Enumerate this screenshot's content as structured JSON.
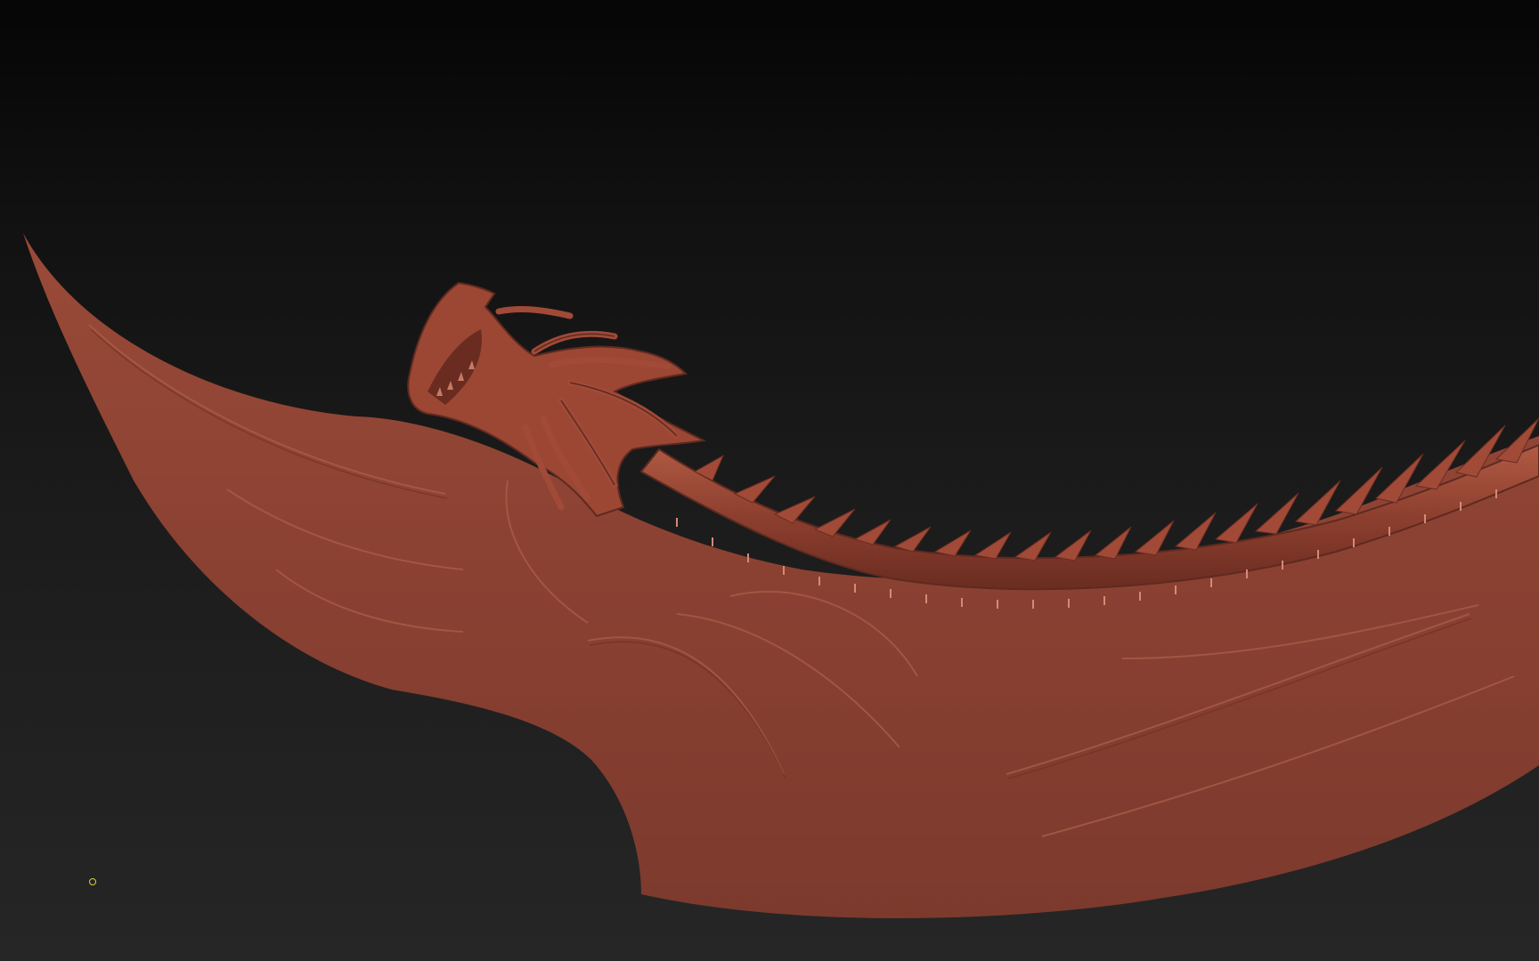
{
  "viewport": {
    "background_top": "#050505",
    "background_bottom": "#262626"
  },
  "model": {
    "description_icon": "sculpt-mesh",
    "material_color": "#8a4132",
    "highlight_color": "#b0604a",
    "shadow_color": "#5e2a20"
  },
  "cursor": {
    "icon": "brush-cursor-icon",
    "color": "#d8d23a"
  }
}
